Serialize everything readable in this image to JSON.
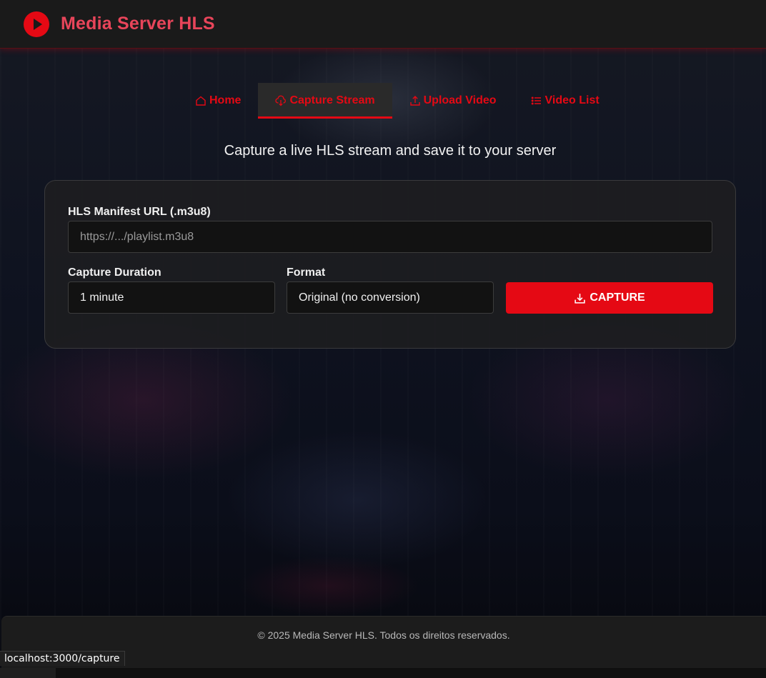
{
  "app": {
    "title": "Media Server HLS",
    "title_part1": "Media Server",
    "title_part2": "HLS",
    "accent_color": "#e50914"
  },
  "nav": {
    "items": [
      {
        "label": "Home",
        "icon": "home-icon",
        "active": false
      },
      {
        "label": "Capture Stream",
        "icon": "cloud-download-icon",
        "active": true
      },
      {
        "label": "Upload Video",
        "icon": "upload-icon",
        "active": false
      },
      {
        "label": "Video List",
        "icon": "list-icon",
        "active": false
      }
    ]
  },
  "main": {
    "subtitle": "Capture a live HLS stream and save it to your server",
    "form": {
      "url_label": "HLS Manifest URL (.m3u8)",
      "url_value": "",
      "url_placeholder": "https://.../playlist.m3u8",
      "duration_label": "Capture Duration",
      "duration_value": "1 minute",
      "format_label": "Format",
      "format_value": "Original (no conversion)",
      "capture_label": "CAPTURE"
    }
  },
  "footer": {
    "text": "© 2025 Media Server HLS. Todos os direitos reservados."
  },
  "statusbar": {
    "url": "localhost:3000/capture"
  }
}
